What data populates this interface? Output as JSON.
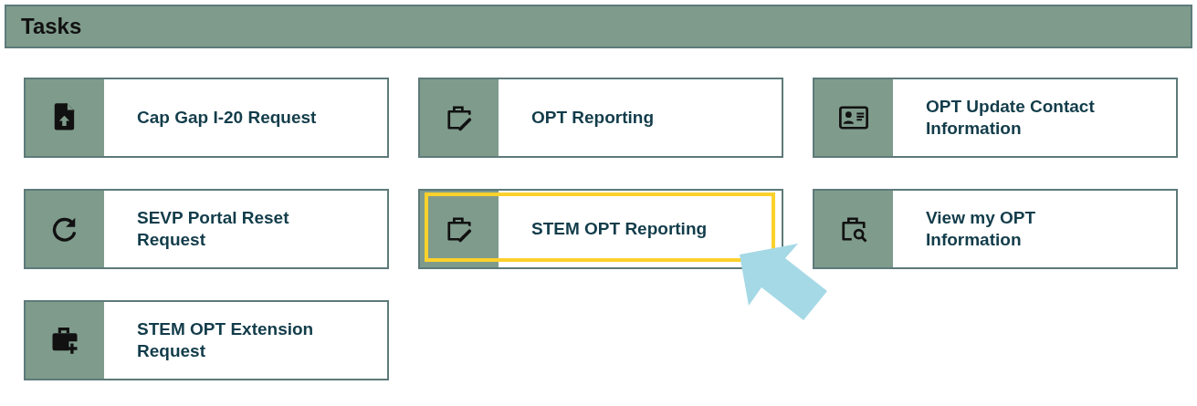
{
  "header": {
    "title": "Tasks"
  },
  "tiles": [
    {
      "label": "Cap Gap I-20 Request",
      "highlighted": false
    },
    {
      "label": "OPT Reporting",
      "highlighted": false
    },
    {
      "label": "OPT Update Contact Information",
      "highlighted": false
    },
    {
      "label": "SEVP Portal Reset Request",
      "highlighted": false
    },
    {
      "label": "STEM OPT Reporting",
      "highlighted": true
    },
    {
      "label": "View my OPT Information",
      "highlighted": false
    },
    {
      "label": "STEM OPT Extension Request",
      "highlighted": false
    }
  ]
}
